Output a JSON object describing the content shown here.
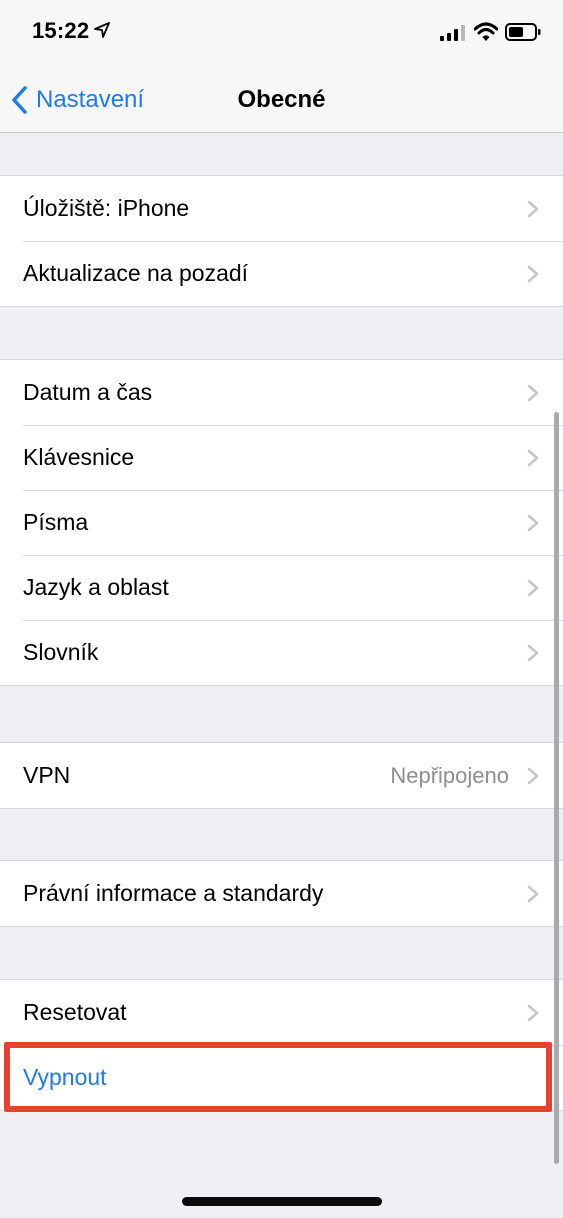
{
  "status_bar": {
    "time": "15:22"
  },
  "nav": {
    "back_label": "Nastavení",
    "title": "Obecné"
  },
  "groups": [
    {
      "rows": [
        {
          "label": "Úložiště: iPhone"
        },
        {
          "label": "Aktualizace na pozadí"
        }
      ]
    },
    {
      "rows": [
        {
          "label": "Datum a čas"
        },
        {
          "label": "Klávesnice"
        },
        {
          "label": "Písma"
        },
        {
          "label": "Jazyk a oblast"
        },
        {
          "label": "Slovník"
        }
      ]
    },
    {
      "rows": [
        {
          "label": "VPN",
          "value": "Nepřipojeno"
        }
      ]
    },
    {
      "rows": [
        {
          "label": "Právní informace a standardy"
        }
      ]
    },
    {
      "rows": [
        {
          "label": "Resetovat"
        },
        {
          "label": "Vypnout"
        }
      ]
    }
  ],
  "colors": {
    "accent": "#1f7aea",
    "highlight": "#e6432f",
    "background": "#efeff4"
  }
}
